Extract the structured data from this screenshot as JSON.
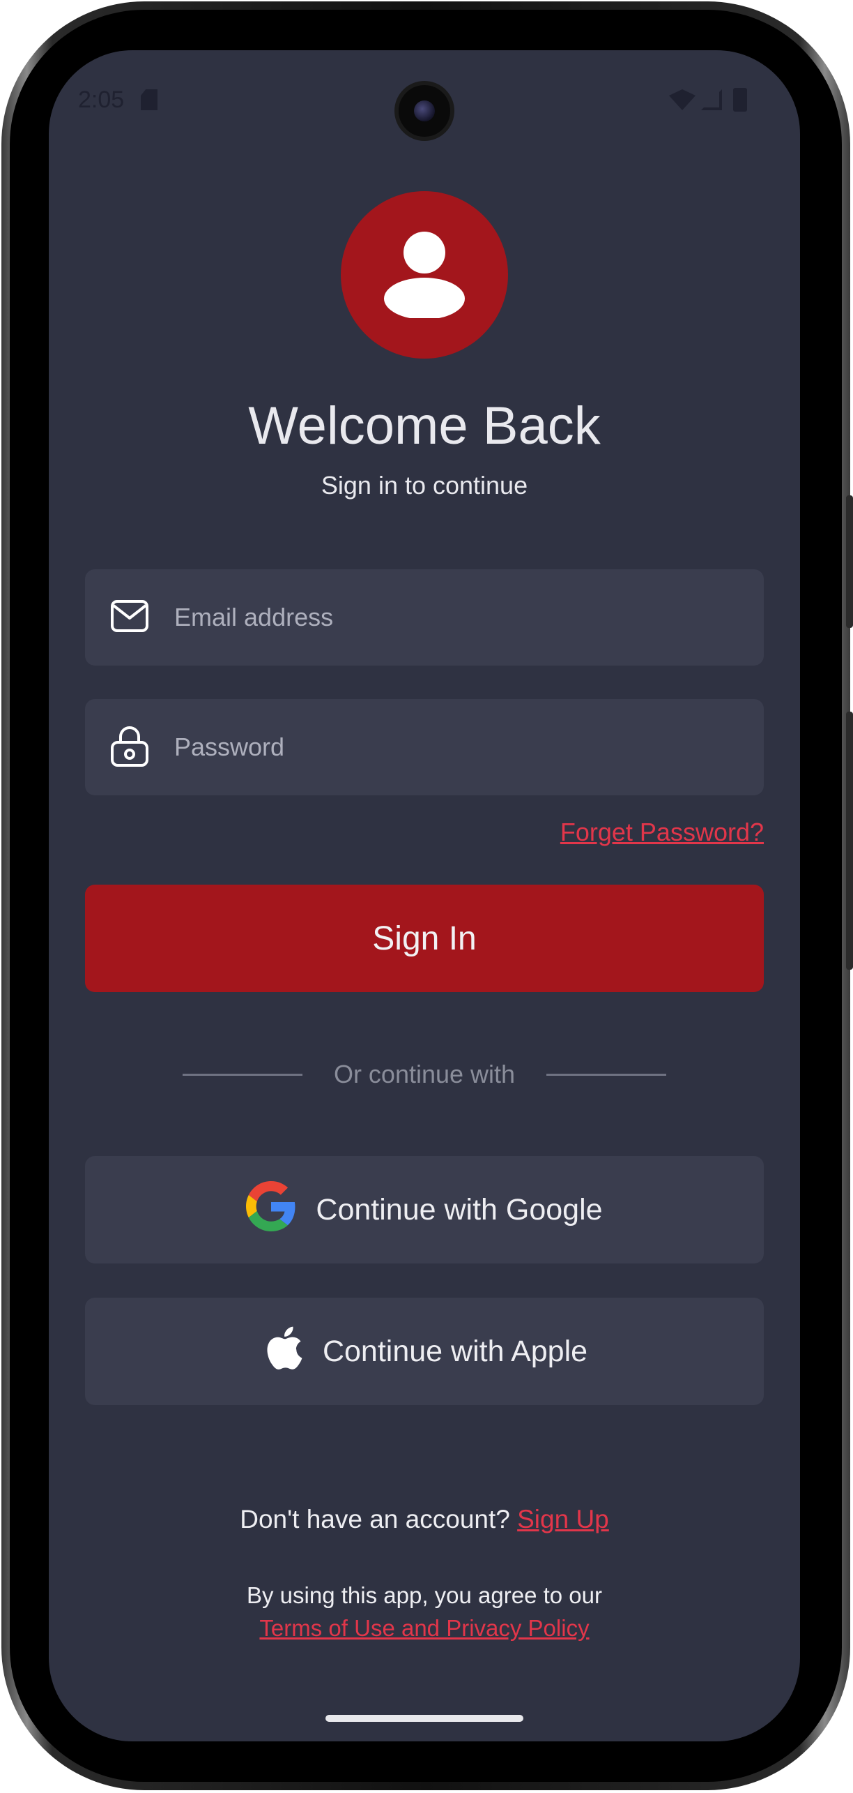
{
  "status_bar": {
    "time": "2:05"
  },
  "header": {
    "title": "Welcome Back",
    "subtitle": "Sign in to continue"
  },
  "form": {
    "email_placeholder": "Email address",
    "password_placeholder": "Password",
    "forgot_label": "Forget Password?",
    "signin_label": "Sign In"
  },
  "divider": {
    "label": "Or continue with"
  },
  "social": {
    "google_label": "Continue with Google",
    "apple_label": "Continue with Apple"
  },
  "footer": {
    "signup_prompt": "Don't have an account?",
    "signup_link": "Sign Up",
    "terms_prefix": "By using this app, you agree to our",
    "terms_link": "Terms of Use and Privacy Policy"
  },
  "colors": {
    "background": "#2f3242",
    "accent": "#a3161c",
    "link": "#e2364a",
    "field": "#3a3d4e"
  },
  "icons": [
    "avatar-person-icon",
    "mail-icon",
    "lock-icon",
    "google-icon",
    "apple-icon"
  ]
}
